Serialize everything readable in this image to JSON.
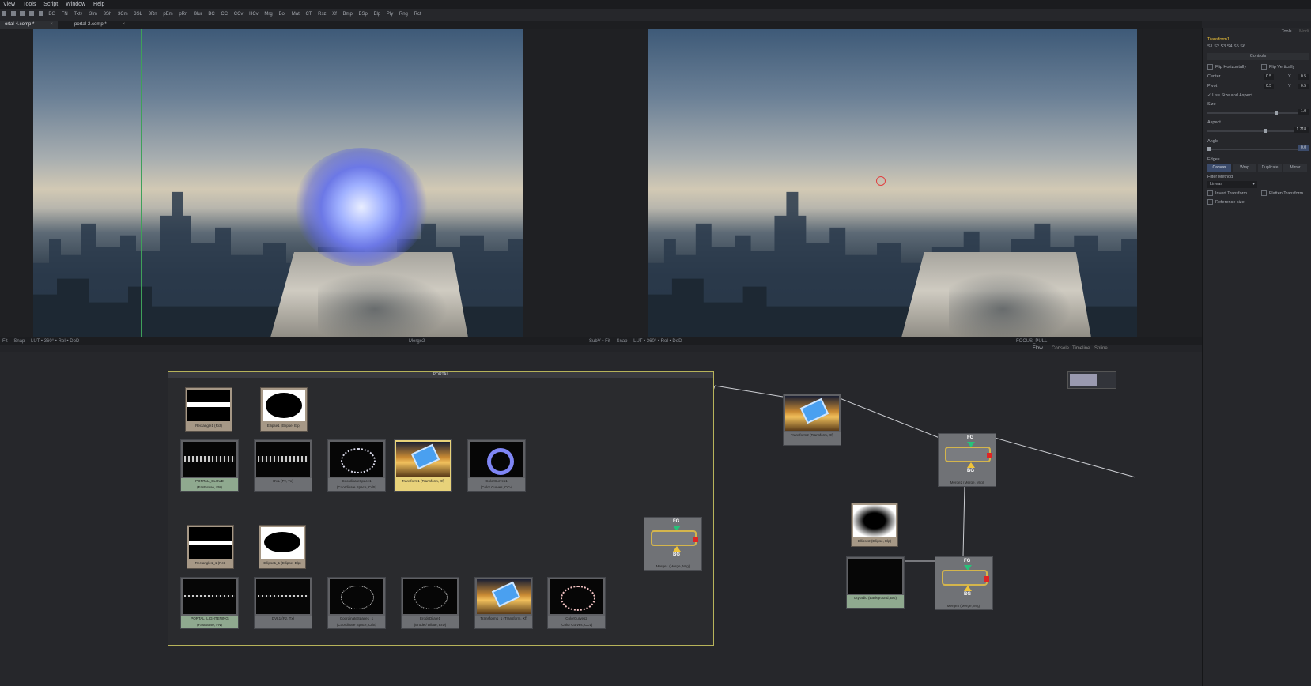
{
  "menu": [
    "View",
    "Tools",
    "Script",
    "Window",
    "Help"
  ],
  "toolbar": [
    "BG",
    "FN",
    "Txt+",
    "3Im",
    "3Sh",
    "3Cm",
    "3SL",
    "3Rn",
    "pEm",
    "pRn",
    "Blur",
    "BC",
    "CC",
    "CCv",
    "HCv",
    "Mrg",
    "Bol",
    "Mat",
    "CT",
    "Rsz",
    "Xf",
    "Bmp",
    "BSp",
    "Elp",
    "Ply",
    "Rng",
    "Rct"
  ],
  "tabs": [
    {
      "label": "ortal-4.comp *",
      "close": "×"
    },
    {
      "label": "portal-2.comp *",
      "close": "×"
    }
  ],
  "viewer_left": {
    "status_left": "Fit",
    "status_mid": "LUT • 360° • RoI • DoD",
    "status_right": "Merge2",
    "snap": "Snap"
  },
  "viewer_right": {
    "status_left": "SubV • Fit",
    "status_mid": "LUT • 360° • RoI • DoD",
    "status_right": "FOCUS_PULL",
    "snap": "Snap"
  },
  "flow_header": {
    "flow": "Flow",
    "console": "Console",
    "timeline": "Timeline",
    "spline": "Spline"
  },
  "inspector": {
    "tab_tools": "Tools",
    "tab_modifiers": "Modi",
    "node_title": "Transform1",
    "versions": "S1  S2  S3  S4  S5  S6",
    "section": "Controls",
    "flip_h": "Flip Horizontally",
    "flip_v": "Flip Vertically",
    "center_label": "Center",
    "center_x_label": "X",
    "center_x": "0.5",
    "center_y_label": "Y",
    "center_y": "0.5",
    "pivot_label": "Pivot",
    "pivot_x_label": "X",
    "pivot_x": "0.5",
    "pivot_y_label": "Y",
    "pivot_y": "0.5",
    "use_size_aspect": "Use Size and Aspect",
    "size_label": "Size",
    "size_val": "1.0",
    "aspect_label": "Aspect",
    "aspect_val": "1.718",
    "angle_label": "Angle",
    "angle_val": "0.0",
    "edges_label": "Edges",
    "edges": [
      "Canvas",
      "Wrap",
      "Duplicate",
      "Mirror"
    ],
    "filter_label": "Filter Method",
    "filter_val": "Linear",
    "invert": "Invert Transform",
    "flatten": "Flatten Transform",
    "ref_size": "Reference size"
  },
  "group_title": "PORTAL",
  "nodes": {
    "rect1": "Rectangle1 (Rct)",
    "ellipse1": "Ellipse1 (Ellipse, Elp)",
    "portal_cloud": "PORTAL_CLOUD\n(FastNoise, FN)",
    "dvl1": "DVL (Pz, Tx)",
    "coord1": "CoordinateSpace1\n(Coordinate Space, CdS)",
    "transform1": "Transform1 (Transform, Xf)",
    "colorcurves1": "ColorCurves1\n(Color Curves, CCv)",
    "rect1b": "Rectangle1_1 (Rct)",
    "ellipse1b": "Ellipse1_1 (Ellipse, Elp)",
    "portal_light": "PORTAL_LIGHTENING\n(FastNoise, FN)",
    "dvl1b": "DVL1 (Pz, Tx)",
    "coord1b": "CoordinateSpace1_1\n(Coordinate Space, CdS)",
    "erode1": "ErodeDilate1\n(Erode / Dilate, ErD)",
    "transform1b": "Transform1_1 (Transform, Xf)",
    "colorcurves2": "ColorCurves2\n(Color Curves, CCv)",
    "merge1": "Merge1 (Merge, Mrg)",
    "transform2": "Transform2 (Transform, Xf)",
    "merge2": "Merge2 (Merge, Mrg)",
    "ellipse2": "Ellipse2 (Ellipse, Elp)",
    "bg": "cityradio (Background, BG)",
    "merge3": "Merge3 (Merge, Mrg)",
    "fg": "FG",
    "bgtxt": "BG"
  }
}
